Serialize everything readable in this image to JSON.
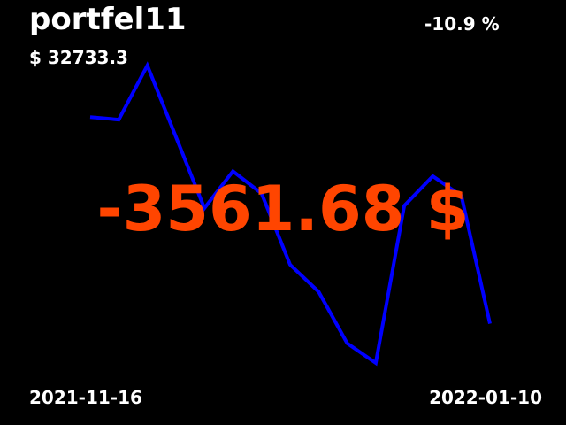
{
  "portfolio": {
    "name": "portfel11",
    "total_value": "$ 32733.3",
    "change_percent": "-10.9 %",
    "change_amount": "-3561.68 $",
    "change_color": "#ff4500"
  },
  "period": {
    "start_date": "2021-11-16",
    "end_date": "2022-01-10"
  },
  "chart_data": {
    "type": "line",
    "line_color": "#0000ff",
    "values": [
      100,
      99,
      121,
      92,
      63,
      78,
      69,
      40,
      29,
      8,
      0,
      64,
      76,
      68,
      16
    ],
    "grid": false,
    "legend": "none"
  }
}
